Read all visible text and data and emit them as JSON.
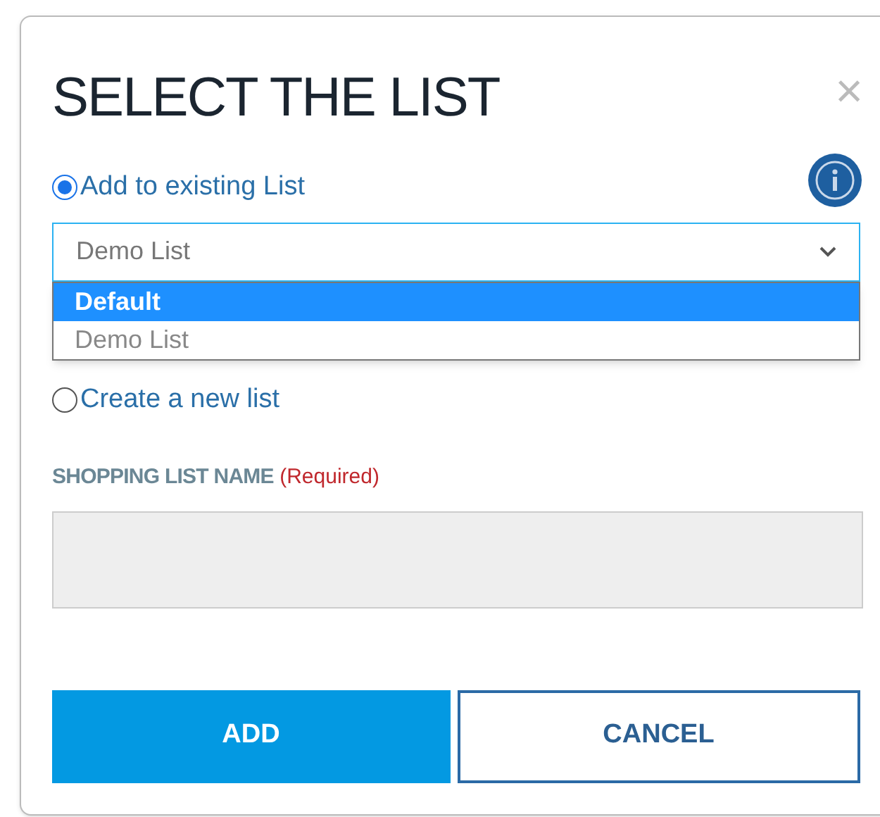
{
  "dialog": {
    "title": "SELECT THE LIST",
    "close": "×"
  },
  "options": [
    {
      "label": "Add to existing List",
      "selected": true
    },
    {
      "label": "Create a new list",
      "selected": false
    }
  ],
  "list_select": {
    "value": "Demo List",
    "expanded": true,
    "items": [
      {
        "label": "Default",
        "highlighted": true
      },
      {
        "label": "Demo List",
        "highlighted": false
      }
    ]
  },
  "name_field": {
    "label": "SHOPPING LIST NAME",
    "hint": "(Required)",
    "disabled": true
  },
  "buttons": [
    {
      "label": "ADD",
      "kind": "primary"
    },
    {
      "label": "CANCEL",
      "kind": "secondary"
    }
  ]
}
